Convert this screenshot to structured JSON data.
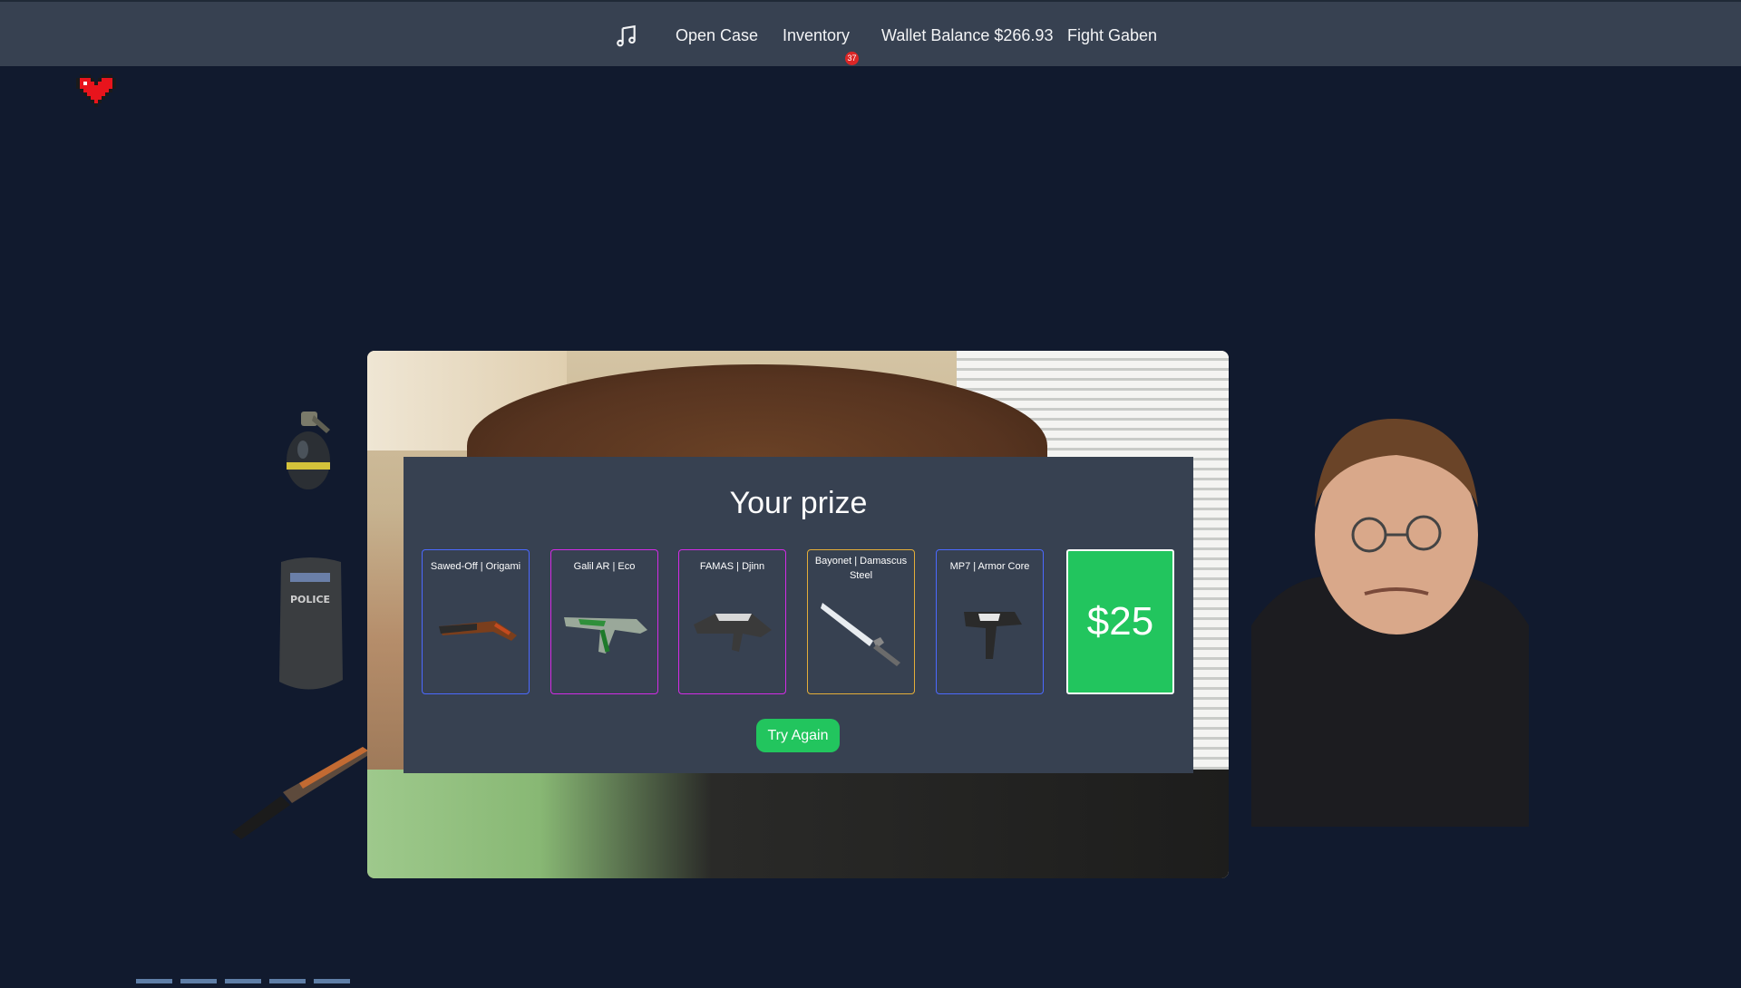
{
  "navbar": {
    "music_icon": "music-note-icon",
    "items": [
      {
        "label": "Open Case"
      },
      {
        "label": "Inventory"
      },
      {
        "label": "Wallet Balance $266.93"
      },
      {
        "label": "Fight Gaben"
      }
    ],
    "inventory_badge": "37"
  },
  "lives": {
    "icon": "pixel-heart-icon"
  },
  "side_items": [
    {
      "icon": "grenade-icon"
    },
    {
      "icon": "police-shield-icon"
    },
    {
      "icon": "knife-icon"
    }
  ],
  "prize_modal": {
    "title": "Your prize",
    "cards": [
      {
        "name": "Sawed-Off | Origami",
        "rarity_color": "#4b69ff"
      },
      {
        "name": "Galil AR | Eco",
        "rarity_color": "#d32ce6"
      },
      {
        "name": "FAMAS | Djinn",
        "rarity_color": "#d32ce6"
      },
      {
        "name": "Bayonet | Damascus Steel",
        "rarity_color": "#e4ae39"
      },
      {
        "name": "MP7 | Armor Core",
        "rarity_color": "#4b69ff"
      }
    ],
    "cash_prize": "$25",
    "try_again_label": "Try Again"
  },
  "colors": {
    "background": "#111a2e",
    "navbar": "#374151",
    "accent_green": "#22c55e",
    "badge_red": "#dc2626"
  }
}
